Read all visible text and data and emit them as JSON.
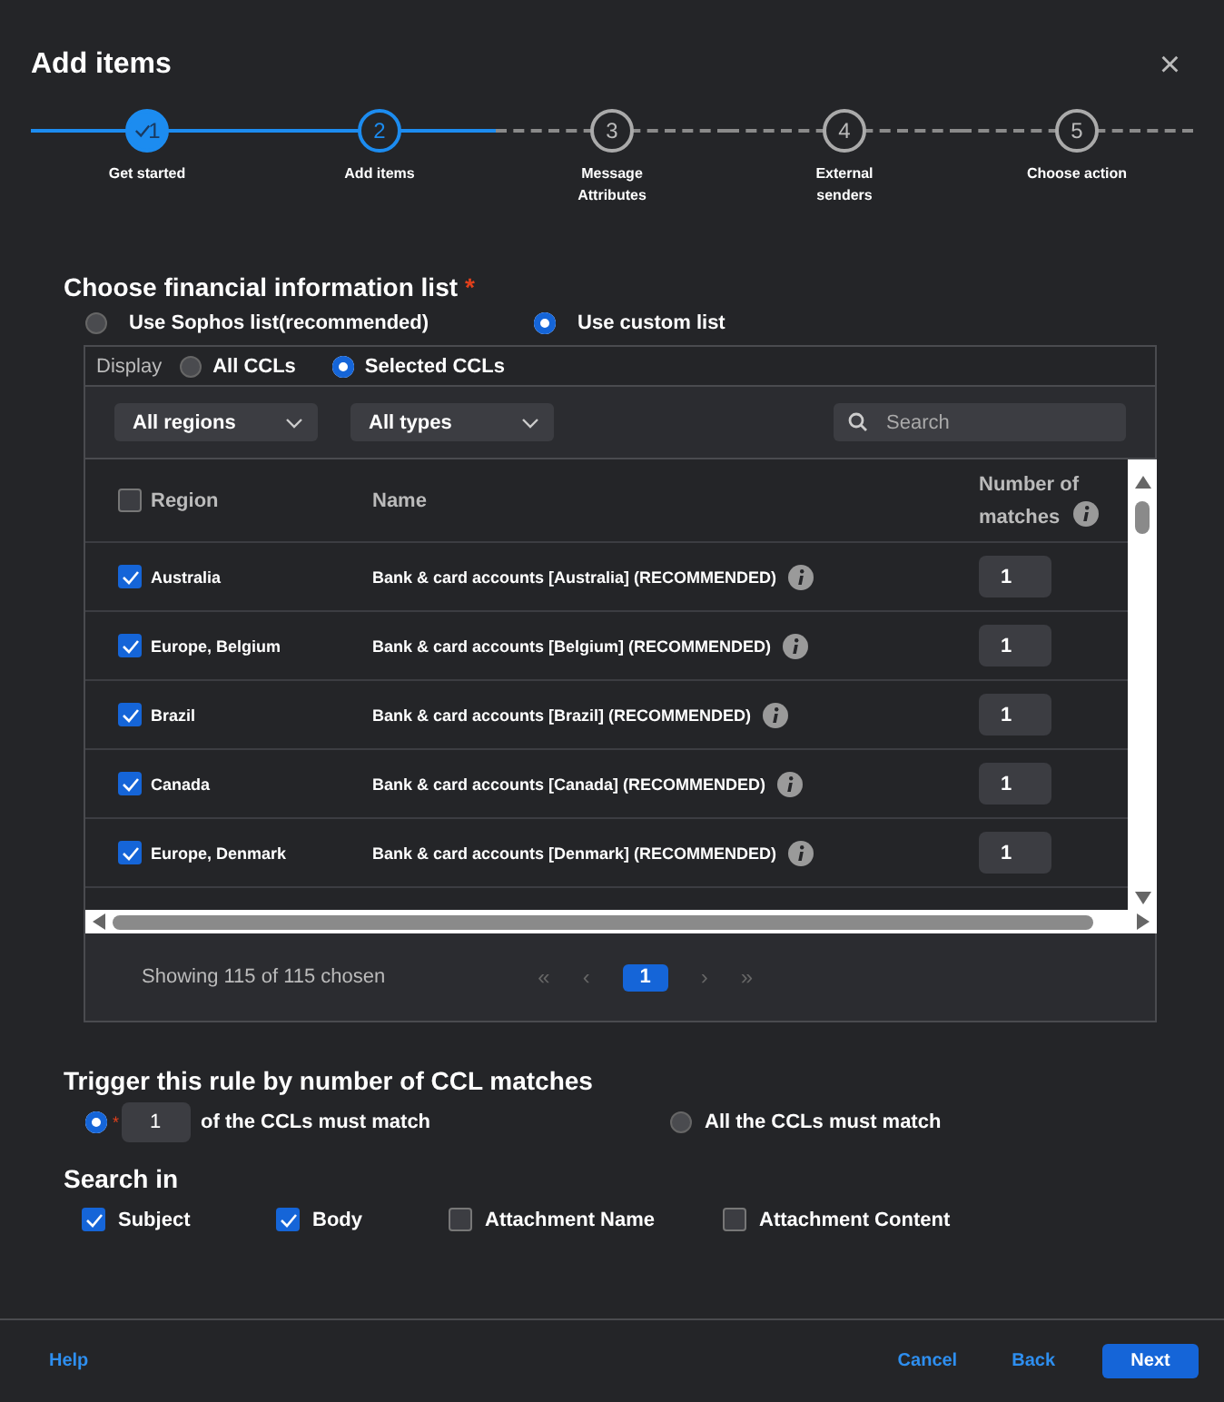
{
  "dialog": {
    "title": "Add items",
    "close": "×"
  },
  "steps": [
    {
      "number": "1",
      "label": "Get started",
      "completed": true,
      "selected": false
    },
    {
      "number": "2",
      "label": "Add items",
      "completed": false,
      "selected": true
    },
    {
      "number": "3",
      "label": "Message Attributes",
      "completed": false,
      "selected": false
    },
    {
      "number": "4",
      "label": "External senders",
      "completed": false,
      "selected": false
    },
    {
      "number": "5",
      "label": "Choose action",
      "completed": false,
      "selected": false
    }
  ],
  "list_section": {
    "title": "Choose financial information list",
    "required_mark": "*",
    "options": [
      {
        "label": "Use Sophos list(recommended)",
        "selected": false
      },
      {
        "label": "Use custom list",
        "selected": true
      }
    ]
  },
  "display": {
    "label": "Display",
    "options": [
      {
        "label": "All CCLs",
        "selected": false
      },
      {
        "label": "Selected CCLs",
        "selected": true
      }
    ]
  },
  "filters": {
    "region": "All regions",
    "type": "All types",
    "search_placeholder": "Search"
  },
  "table": {
    "select_all": false,
    "columns": [
      "Region",
      "Name",
      "Number of matches"
    ],
    "rows": [
      {
        "checked": true,
        "region": "Australia",
        "name": "Bank & card accounts [Australia] (RECOMMENDED)",
        "matches": "1"
      },
      {
        "checked": true,
        "region": "Europe, Belgium",
        "name": "Bank & card accounts [Belgium] (RECOMMENDED)",
        "matches": "1"
      },
      {
        "checked": true,
        "region": "Brazil",
        "name": "Bank & card accounts [Brazil] (RECOMMENDED)",
        "matches": "1"
      },
      {
        "checked": true,
        "region": "Canada",
        "name": "Bank & card accounts [Canada] (RECOMMENDED)",
        "matches": "1"
      },
      {
        "checked": true,
        "region": "Europe, Denmark",
        "name": "Bank & card accounts [Denmark] (RECOMMENDED)",
        "matches": "1"
      }
    ]
  },
  "pagination": {
    "summary": "Showing 115 of 115 chosen",
    "first": "«",
    "prev": "‹",
    "pages": [
      {
        "label": "1",
        "selected": true
      }
    ],
    "next": "›",
    "last": "»"
  },
  "trigger": {
    "title": "Trigger this rule by number of CCL matches",
    "options": [
      {
        "kind": "count",
        "required_mark": "*",
        "value": "1",
        "label": "of the CCLs must match",
        "selected": true
      },
      {
        "kind": "plain",
        "label": "All the CCLs must match",
        "selected": false
      }
    ]
  },
  "search_in": {
    "title": "Search in",
    "items": [
      {
        "label": "Subject",
        "checked": true
      },
      {
        "label": "Body",
        "checked": true
      },
      {
        "label": "Attachment Name",
        "checked": false
      },
      {
        "label": "Attachment Content",
        "checked": false
      }
    ]
  },
  "footer": {
    "help": "Help",
    "cancel": "Cancel",
    "back": "Back",
    "next": "Next"
  }
}
